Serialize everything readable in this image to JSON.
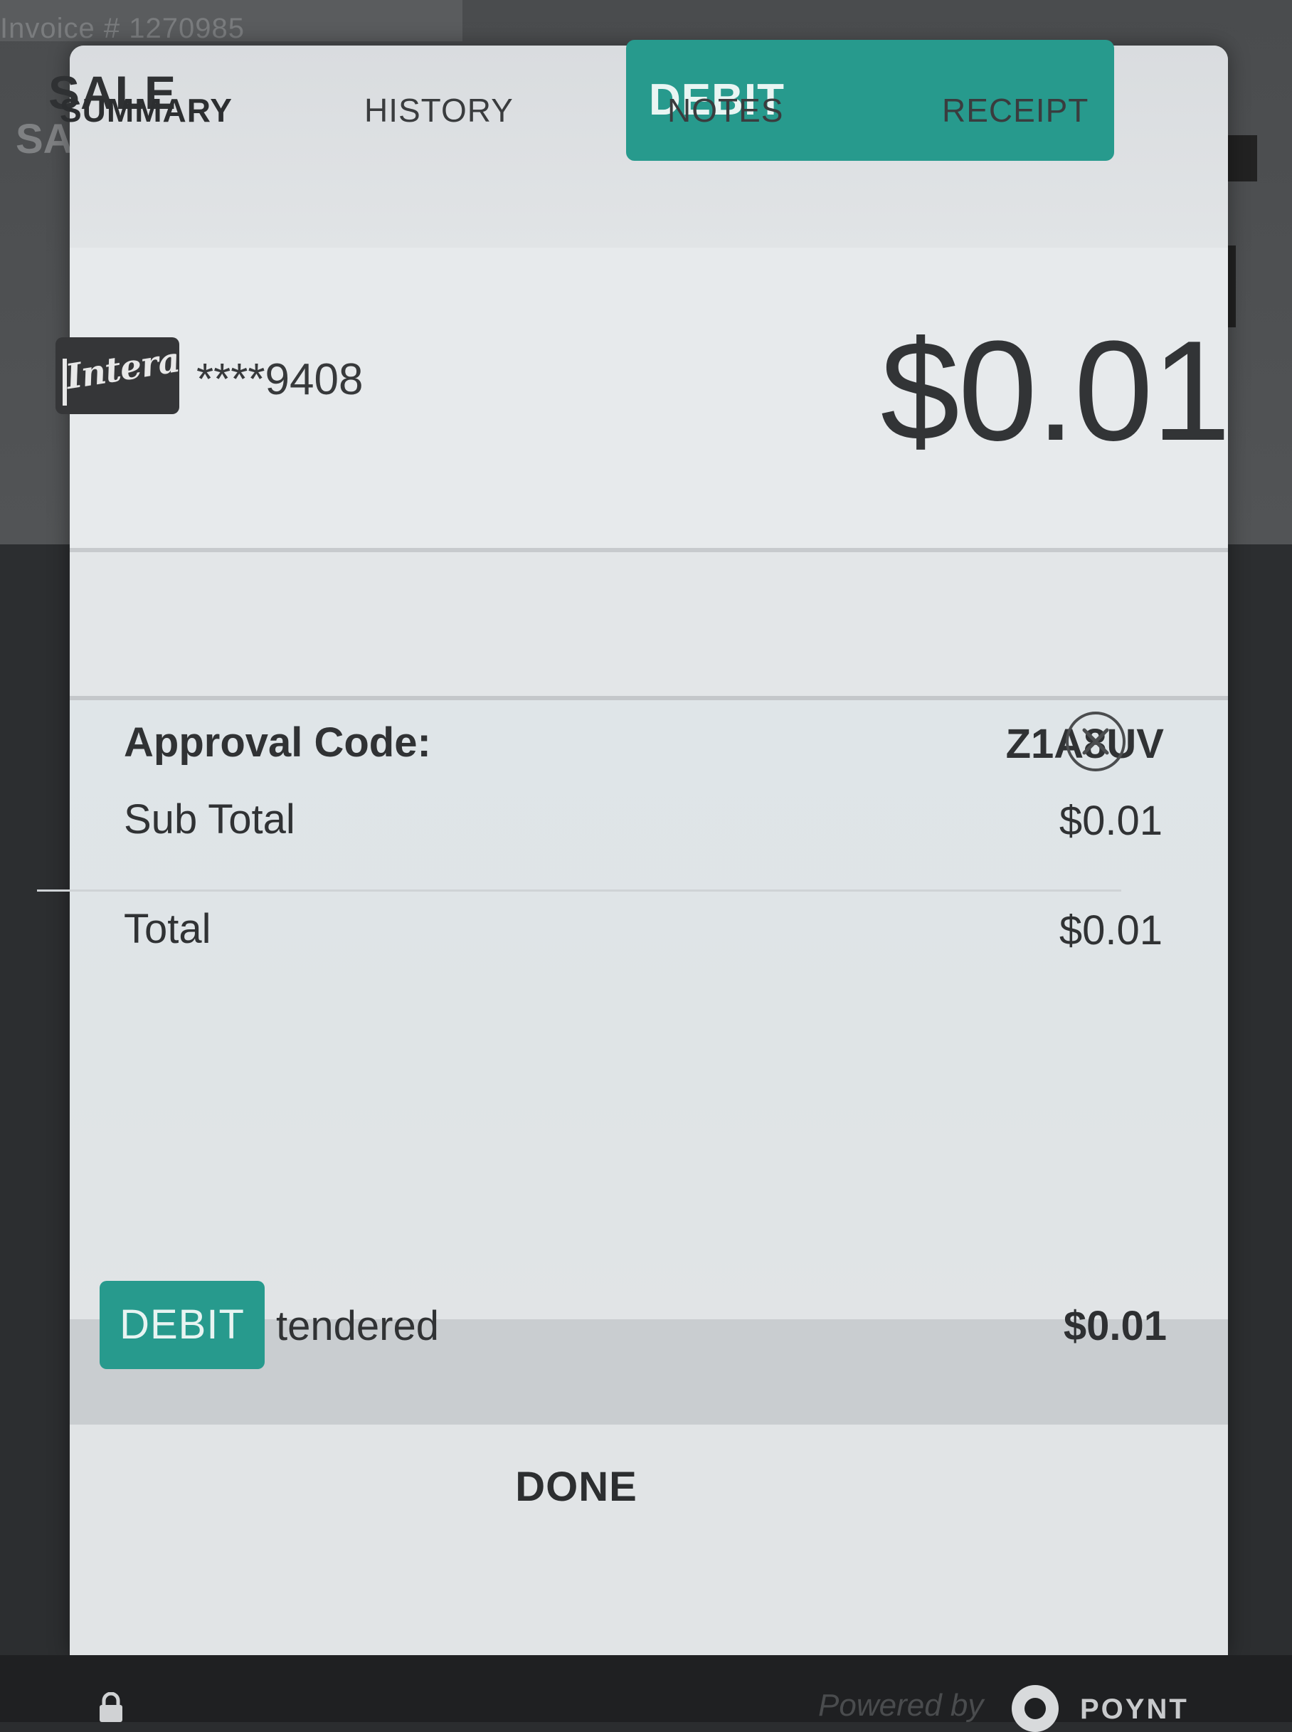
{
  "background": {
    "invoice_text": "Invoice # 1270985",
    "sale_text": "SA"
  },
  "header": {
    "title": "SALE",
    "payment_method": "DEBIT"
  },
  "card": {
    "brand_logo_text": "Interac",
    "masked_number": "****9408",
    "amount": "$0.01"
  },
  "tabs": [
    {
      "label": "SUMMARY",
      "active": true
    },
    {
      "label": "HISTORY",
      "active": false
    },
    {
      "label": "NOTES",
      "active": false
    },
    {
      "label": "RECEIPT",
      "active": false
    }
  ],
  "summary": {
    "approval_label": "Approval Code:",
    "approval_code": "Z1A8UV",
    "subtotal_label": "Sub Total",
    "subtotal_value": "$0.01",
    "total_label": "Total",
    "total_value": "$0.01"
  },
  "tender": {
    "badge": "DEBIT",
    "label": "tendered",
    "amount": "$0.01"
  },
  "footer": {
    "done_label": "DONE"
  },
  "bottom_bar": {
    "powered_by": "Powered by",
    "brand": "POYNT"
  },
  "colors": {
    "accent": "#279a8d",
    "modal_background": "#e6e9eb",
    "text_dark": "#303234"
  }
}
